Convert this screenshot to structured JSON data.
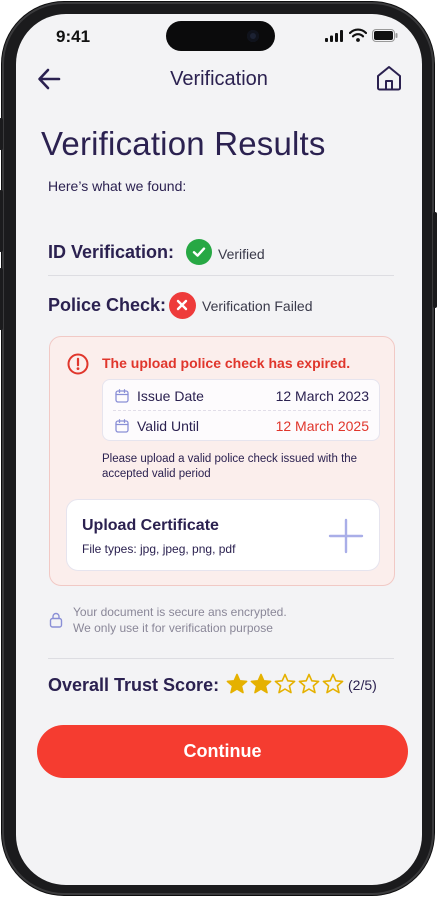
{
  "status_bar": {
    "time": "9:41",
    "icons": [
      "signal-icon",
      "wifi-icon",
      "battery-icon"
    ]
  },
  "nav": {
    "title": "Verification",
    "back_icon": "arrow-left-icon",
    "home_icon": "home-icon"
  },
  "page": {
    "title": "Verification Results",
    "subtitle": "Here’s what we found:"
  },
  "id_verification": {
    "label": "ID Verification:",
    "status": "Verified",
    "icon": "check-circle-icon",
    "color": "#27a844"
  },
  "police_check": {
    "label": "Police Check:",
    "status": "Verification Failed",
    "icon": "x-circle-icon",
    "color": "#ee3b3b",
    "alert": {
      "title": "The upload police check has expired.",
      "title_color": "#e0362c",
      "issue_date_label": "Issue Date",
      "issue_date": "12 March 2023",
      "valid_until_label": "Valid Until",
      "valid_until": "12 March 2025",
      "valid_until_color": "#e0362c",
      "note": "Please upload a valid police check issued with the accepted valid period",
      "upload": {
        "title": "Upload Certificate",
        "file_types": "File types: jpg, jpeg, png, pdf",
        "icon": "plus-icon"
      }
    }
  },
  "security_note": {
    "line1": "Your document is secure ans encrypted.",
    "line2": "We only use it for verification purpose",
    "icon": "lock-icon"
  },
  "trust_score": {
    "label": "Overall Trust Score:",
    "rating": 2,
    "max": 5,
    "text": "(2/5)",
    "star_color": "#e5b100"
  },
  "actions": {
    "continue_label": "Continue",
    "accent": "#f53c30"
  }
}
